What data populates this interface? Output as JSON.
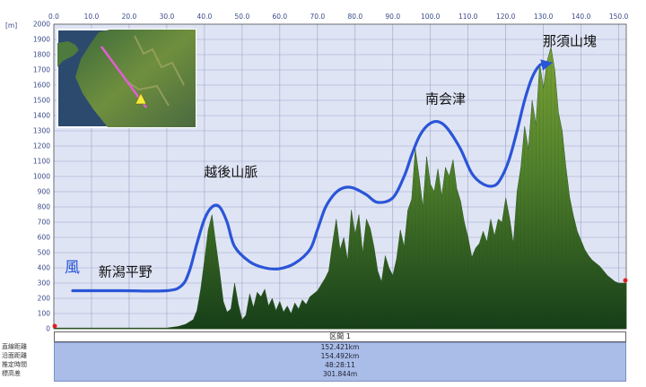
{
  "chart_data": {
    "type": "area",
    "x_unit": "[km]",
    "y_unit": "[m]",
    "xlim": [
      0,
      152
    ],
    "ylim": [
      0,
      2000
    ],
    "x_ticks": [
      "0.0",
      "10.0",
      "20.0",
      "30.0",
      "40.0",
      "50.0",
      "60.0",
      "70.0",
      "80.0",
      "90.0",
      "100.0",
      "110.0",
      "120.0",
      "130.0",
      "140.0",
      "150.0"
    ],
    "y_ticks": [
      "0",
      "100",
      "200",
      "300",
      "400",
      "500",
      "600",
      "700",
      "800",
      "900",
      "1000",
      "1100",
      "1200",
      "1300",
      "1400",
      "1500",
      "1600",
      "1700",
      "1800",
      "1900",
      "2000"
    ],
    "grid": true,
    "profile": {
      "x": [
        0,
        5,
        10,
        15,
        20,
        25,
        30,
        33,
        35,
        37,
        38,
        39,
        40,
        41,
        42,
        43,
        44,
        45,
        46,
        47,
        48,
        49,
        50,
        51,
        52,
        53,
        54,
        55,
        56,
        57,
        58,
        59,
        60,
        61,
        62,
        63,
        64,
        65,
        66,
        67,
        68,
        70,
        72,
        73,
        74,
        75,
        76,
        77,
        78,
        79,
        80,
        81,
        82,
        83,
        84,
        85,
        86,
        87,
        88,
        89,
        90,
        91,
        92,
        93,
        94,
        95,
        96,
        97,
        98,
        99,
        100,
        101,
        102,
        103,
        104,
        105,
        106,
        107,
        108,
        109,
        110,
        111,
        112,
        113,
        114,
        115,
        116,
        117,
        118,
        119,
        120,
        121,
        122,
        123,
        124,
        125,
        126,
        127,
        128,
        129,
        130,
        131,
        132,
        133,
        134,
        135,
        136,
        137,
        138,
        139,
        140,
        141,
        142,
        143,
        144,
        145,
        146,
        147,
        148,
        149,
        150,
        151,
        152
      ],
      "y": [
        5,
        5,
        5,
        5,
        5,
        5,
        5,
        15,
        30,
        60,
        120,
        260,
        450,
        650,
        750,
        560,
        380,
        180,
        110,
        130,
        300,
        160,
        60,
        90,
        230,
        140,
        240,
        210,
        260,
        150,
        200,
        120,
        180,
        110,
        150,
        100,
        170,
        130,
        190,
        160,
        210,
        250,
        330,
        380,
        560,
        720,
        520,
        600,
        450,
        780,
        620,
        750,
        500,
        720,
        660,
        540,
        380,
        310,
        480,
        400,
        350,
        460,
        650,
        540,
        780,
        850,
        1180,
        1000,
        800,
        1130,
        950,
        900,
        1050,
        870,
        1060,
        1000,
        1110,
        920,
        840,
        700,
        600,
        470,
        530,
        560,
        640,
        570,
        720,
        610,
        720,
        700,
        860,
        730,
        560,
        900,
        1060,
        1330,
        1180,
        1500,
        1340,
        1740,
        1580,
        1760,
        1850,
        1700,
        1420,
        1300,
        1060,
        860,
        740,
        640,
        580,
        520,
        480,
        450,
        430,
        410,
        380,
        350,
        330,
        310,
        300,
        300,
        300
      ]
    },
    "wind_path": {
      "x": [
        5,
        18,
        30,
        34,
        36,
        38,
        40,
        42,
        44,
        46,
        48,
        52,
        56,
        60,
        64,
        68,
        70,
        72,
        74,
        76,
        78,
        80,
        83,
        86,
        90,
        93,
        95,
        97,
        99,
        101,
        103,
        105,
        108,
        111,
        114,
        117,
        119,
        121,
        123,
        125,
        127,
        129,
        131
      ],
      "y": [
        250,
        250,
        250,
        285,
        380,
        560,
        720,
        800,
        800,
        700,
        540,
        440,
        400,
        395,
        430,
        520,
        650,
        790,
        870,
        915,
        930,
        920,
        880,
        830,
        860,
        1000,
        1140,
        1260,
        1330,
        1360,
        1350,
        1300,
        1180,
        1020,
        950,
        940,
        1000,
        1120,
        1300,
        1500,
        1650,
        1730,
        1740
      ]
    },
    "annotations": [
      {
        "text": "新潟平野",
        "x": 19,
        "y": 345
      },
      {
        "text": "越後山脈",
        "x": 47,
        "y": 1000
      },
      {
        "text": "南会津",
        "x": 104,
        "y": 1480
      },
      {
        "text": "那須山塊",
        "x": 137,
        "y": 1860
      }
    ],
    "wind_label": "風"
  },
  "section_label": "区間 1",
  "info": {
    "labels": [
      "直線距離",
      "沿面距離",
      "推定時間",
      "標高差"
    ],
    "values": [
      "152.421km",
      "154.492km",
      "48:28:11",
      "301.844m"
    ]
  },
  "colors": {
    "plot_background": "#dfe4f4",
    "grid": "#9aa3c8",
    "terrain_top": "#7aa235",
    "terrain_bottom": "#173e19",
    "wind_arrow": "#2a55d8",
    "info_panel": "#a9bde8",
    "route_line": "#e060d0",
    "marker": "#f5ec3a"
  },
  "inset_map": {
    "icon": "terrain-map-icon"
  }
}
